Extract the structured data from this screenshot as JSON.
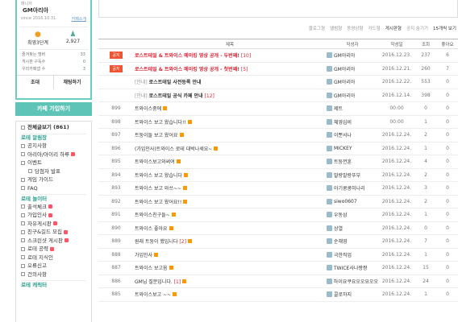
{
  "cafe": {
    "label": "매니저",
    "name": "GM아리아",
    "since": "since 2016.10.31.",
    "intro_link": "카페소개",
    "level": "최영3단계",
    "members": "2,927",
    "member_stats": [
      {
        "label": "즐겨찾는 멤버",
        "value": "33"
      },
      {
        "label": "게시판 구독수",
        "value": "0"
      },
      {
        "label": "우리카페앱 수",
        "value": "3"
      }
    ],
    "invite": "초대",
    "chat": "채팅하기",
    "join": "카페 가입하기"
  },
  "menu": {
    "all": "전체글보기 (861)",
    "items": [
      {
        "text": "로테 알림장",
        "type": "section"
      },
      {
        "text": "공지사항",
        "type": "item"
      },
      {
        "text": "아리아/아이리 하루",
        "type": "item",
        "badge": true
      },
      {
        "text": "이벤트",
        "type": "item"
      },
      {
        "text": "당첨자 발표",
        "type": "sub"
      },
      {
        "text": "게임 가이드",
        "type": "item"
      },
      {
        "text": "FAQ",
        "type": "item"
      },
      {
        "text": "로테 놀이터",
        "type": "section"
      },
      {
        "text": "출석체크",
        "type": "item",
        "badge": true
      },
      {
        "text": "가입인사",
        "type": "item",
        "badge": true
      },
      {
        "text": "자유게시판",
        "type": "item",
        "badge": true
      },
      {
        "text": "친구&길드 모집",
        "type": "item",
        "badge": true
      },
      {
        "text": "스크린샷 게시판",
        "type": "item",
        "badge": true
      },
      {
        "text": "로테 공략",
        "type": "item",
        "badge": true
      },
      {
        "text": "로테 지식인",
        "type": "item"
      },
      {
        "text": "오류신고",
        "type": "item"
      },
      {
        "text": "건의사항",
        "type": "item"
      },
      {
        "text": "로테 캐릭터",
        "type": "section"
      }
    ]
  },
  "toolbar": {
    "options": [
      "블로그형",
      "앨범형",
      "동영상형",
      "카드형",
      "게시판형"
    ],
    "hide_notice": "공지 숨기기",
    "per_page": "15개씩 보기"
  },
  "table": {
    "headers": [
      "",
      "제목",
      "작성자",
      "작성일",
      "조회",
      "좋아요"
    ],
    "rows": [
      {
        "kind": "notice",
        "num": "공지",
        "title": "로스트테일 & 트와이스 메이킹 영상 공개 - 두번째!",
        "comments": "[10]",
        "author": "GM아리아",
        "date": "2016.12.23.",
        "views": "237",
        "likes": "6"
      },
      {
        "kind": "notice",
        "num": "공지",
        "title": "로스트테일 & 트와이스 메이킹 영상 공개 - 첫번째!",
        "comments": "[5]",
        "author": "GM아리아",
        "date": "2016.12.21.",
        "views": "260",
        "likes": "7"
      },
      {
        "kind": "guide",
        "num": "",
        "prefix": "[안내]",
        "title": "로스트테일 사전등록 안내",
        "comments": "",
        "author": "GM아리아",
        "date": "2016.12.22.",
        "views": "553",
        "likes": "0"
      },
      {
        "kind": "guide",
        "num": "",
        "prefix": "[안내]",
        "title": "로스트테일 공식 카페 안내",
        "comments": "[12]",
        "author": "GM아리아",
        "date": "2016.12.14.",
        "views": "398",
        "likes": "0"
      },
      {
        "kind": "post",
        "num": "899",
        "title": "트와이스중에",
        "comments": "",
        "author": "제트",
        "date": "00:00",
        "views": "0",
        "likes": "0"
      },
      {
        "kind": "post",
        "num": "898",
        "title": "트와이스 보고 왔습니다!!",
        "comments": "",
        "author": "체영심비",
        "date": "00:00",
        "views": "1",
        "likes": "0"
      },
      {
        "kind": "post",
        "num": "897",
        "title": "트둥이들 보고 왔어요",
        "comments": "",
        "author": "이뿐서나",
        "date": "2016.12.24.",
        "views": "2",
        "likes": "0"
      },
      {
        "kind": "post",
        "num": "896",
        "title": "(가입인사)트와이스 로테 대박나세요~",
        "comments": "",
        "author": "MICKEY",
        "date": "2016.12.24.",
        "views": "1",
        "likes": "0"
      },
      {
        "kind": "post",
        "num": "895",
        "title": "트와이스보고와써여",
        "comments": "",
        "author": "트둥껀훈",
        "date": "2016.12.24.",
        "views": "4",
        "likes": "0"
      },
      {
        "kind": "post",
        "num": "894",
        "title": "트와이스 보고 왔습니다",
        "comments": "",
        "author": "말랑말랑뚜부",
        "date": "2016.12.24.",
        "views": "2",
        "likes": "0"
      },
      {
        "kind": "post",
        "num": "893",
        "title": "트와이스 보고 와쓰~~",
        "comments": "",
        "author": "아기쿵쿵미나리",
        "date": "2016.12.24.",
        "views": "3",
        "likes": "0"
      },
      {
        "kind": "post",
        "num": "892",
        "title": "트와이스 보고 왔어요!!",
        "comments": "",
        "author": "siwo0607",
        "date": "2016.12.24.",
        "views": "2",
        "likes": "0"
      },
      {
        "kind": "post",
        "num": "891",
        "title": "트와이스친구들~",
        "comments": "",
        "author": "우동삼",
        "date": "2016.12.24.",
        "views": "1",
        "likes": "0"
      },
      {
        "kind": "post",
        "num": "890",
        "title": "트와이스 좋아요",
        "comments": "",
        "author": "상열",
        "date": "2016.12.24.",
        "views": "0",
        "likes": "0"
      },
      {
        "kind": "post",
        "num": "889",
        "title": "원래 트둥이 했입니다",
        "comments": "[2]",
        "author": "순채영",
        "date": "2016.12.24.",
        "views": "7",
        "likes": "0"
      },
      {
        "kind": "post",
        "num": "888",
        "title": "가입인사",
        "comments": "",
        "author": "극한직업",
        "date": "2016.12.24.",
        "views": "1",
        "likes": "0"
      },
      {
        "kind": "post",
        "num": "887",
        "title": "트와이스 보고옴",
        "comments": "",
        "author": "TWICE사나짱짱",
        "date": "2016.12.24.",
        "views": "15",
        "likes": "0"
      },
      {
        "kind": "post",
        "num": "886",
        "title": "GM님 질문입니다.",
        "comments": "[1]",
        "author": "하이요쿠요오오요오오",
        "date": "2016.12.24.",
        "views": "24",
        "likes": "0"
      },
      {
        "kind": "post",
        "num": "885",
        "title": "트와이스보고 ~~",
        "comments": "",
        "author": "콜로하지",
        "date": "2016.12.24.",
        "views": "1",
        "likes": "0"
      }
    ]
  }
}
